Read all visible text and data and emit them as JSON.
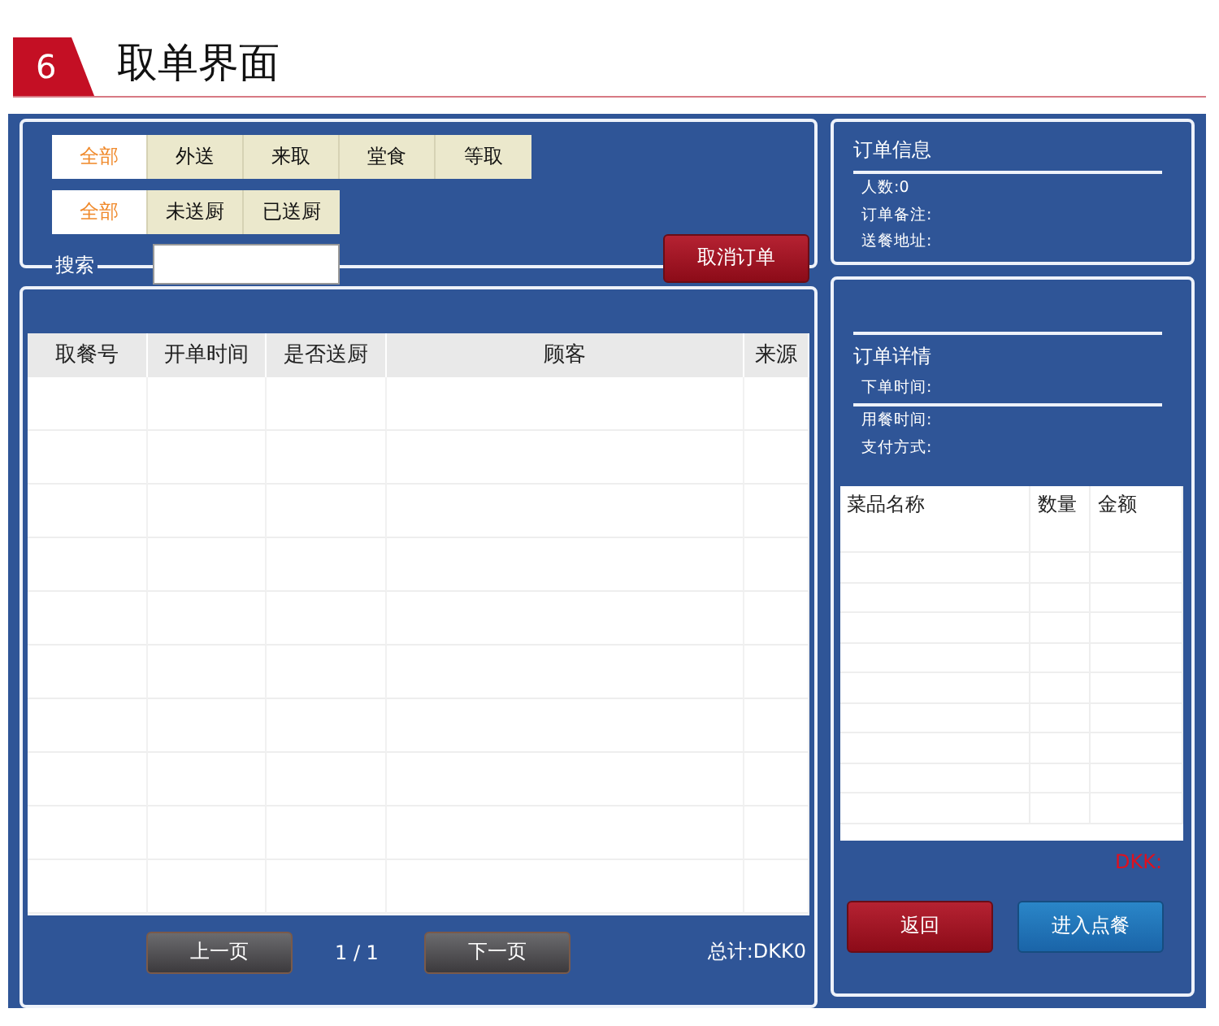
{
  "section": {
    "number": "6",
    "title": "取单界面"
  },
  "order_type_tabs": [
    {
      "label": "全部",
      "selected": true
    },
    {
      "label": "外送",
      "selected": false
    },
    {
      "label": "来取",
      "selected": false
    },
    {
      "label": "堂食",
      "selected": false
    },
    {
      "label": "等取",
      "selected": false
    }
  ],
  "kitchen_tabs": [
    {
      "label": "全部",
      "selected": true
    },
    {
      "label": "未送厨",
      "selected": false
    },
    {
      "label": "已送厨",
      "selected": false
    }
  ],
  "search": {
    "label": "搜索"
  },
  "cancel_button": "取消订单",
  "orders_table": {
    "columns": [
      "取餐号",
      "开单时间",
      "是否送厨",
      "顾客",
      "来源"
    ]
  },
  "pagination": {
    "prev": "上一页",
    "page": "1 / 1",
    "next": "下一页",
    "total": "总计:DKK0"
  },
  "order_info": {
    "title": "订单信息",
    "fields": [
      "人数:0",
      "订单备注:",
      "送餐地址:"
    ]
  },
  "order_details": {
    "title": "订单详情",
    "fields": [
      "下单时间:",
      "用餐时间:",
      "支付方式:"
    ]
  },
  "items_table": {
    "columns": [
      "菜品名称",
      "数量",
      "金额"
    ]
  },
  "amount": "DKK:",
  "back_button": "返回",
  "order_button": "进入点餐"
}
